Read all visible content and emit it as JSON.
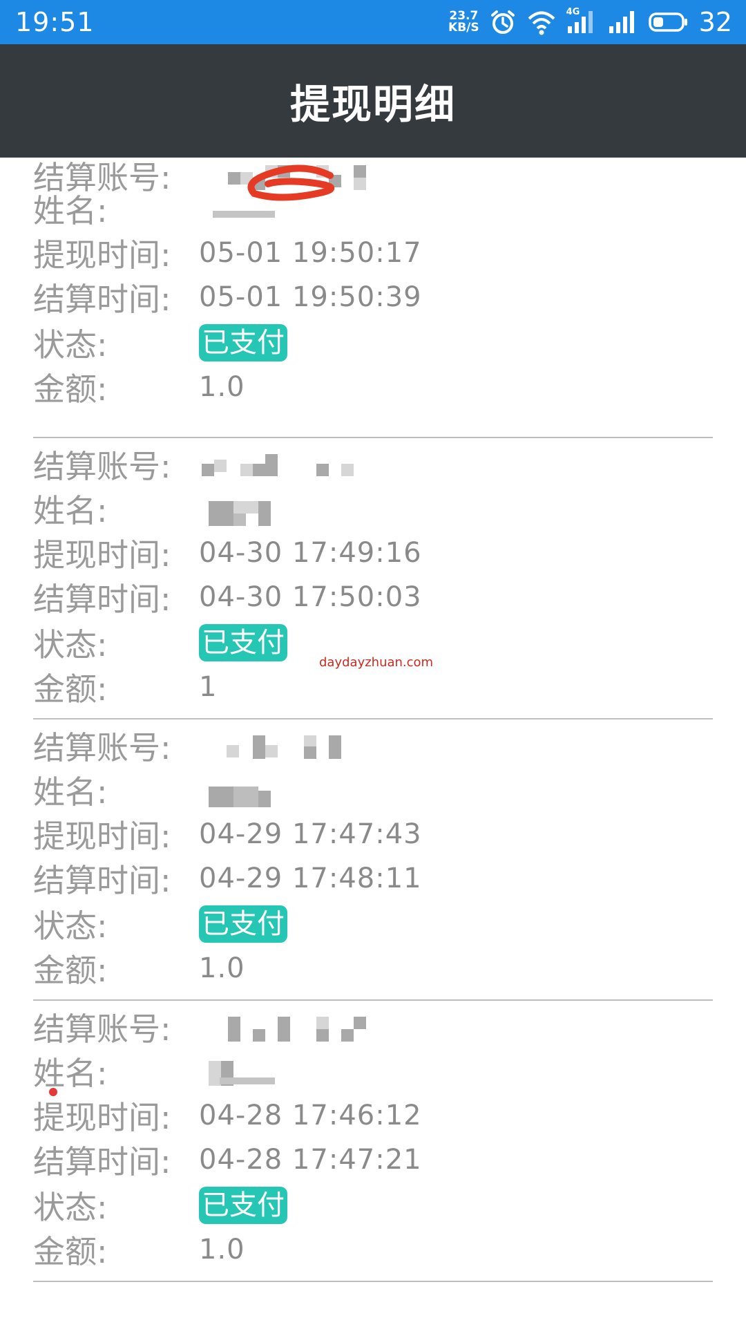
{
  "status_bar": {
    "time": "19:51",
    "net_speed_value": "23.7",
    "net_speed_unit": "KB/S",
    "network_type": "4G",
    "battery": "32",
    "icons": [
      "alarm-icon",
      "wifi-icon",
      "signal-4g-icon",
      "signal-icon",
      "battery-icon"
    ]
  },
  "header": {
    "title": "提现明细"
  },
  "labels": {
    "account": "结算账号:",
    "name": "姓名:",
    "withdraw_time": "提现时间:",
    "settle_time": "结算时间:",
    "status": "状态:",
    "amount": "金额:"
  },
  "records": [
    {
      "withdraw_time": "05-01 19:50:17",
      "settle_time": "05-01 19:50:39",
      "status": "已支付",
      "amount": "1.0"
    },
    {
      "withdraw_time": "04-30 17:49:16",
      "settle_time": "04-30 17:50:03",
      "status": "已支付",
      "amount": "1"
    },
    {
      "withdraw_time": "04-29 17:47:43",
      "settle_time": "04-29 17:48:11",
      "status": "已支付",
      "amount": "1.0"
    },
    {
      "withdraw_time": "04-28 17:46:12",
      "settle_time": "04-28 17:47:21",
      "status": "已支付",
      "amount": "1.0"
    }
  ],
  "watermark": "daydayzhuan.com",
  "colors": {
    "status_bar": "#1e88e5",
    "title_bar": "#353a3f",
    "badge": "#26c6b4",
    "label": "#9a9a9a",
    "divider": "#bdbdbd",
    "scribble": "#e53b24"
  }
}
